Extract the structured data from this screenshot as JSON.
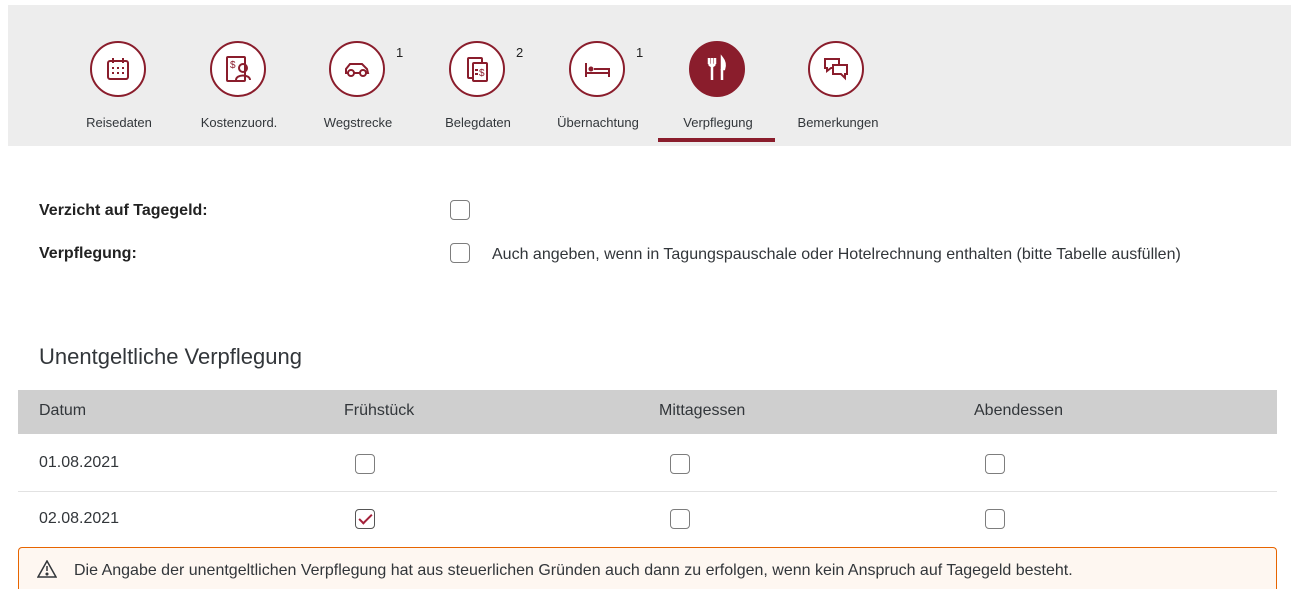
{
  "tabs": [
    {
      "label": "Reisedaten",
      "icon": "calendar-icon",
      "count": "",
      "active": false
    },
    {
      "label": "Kostenzuord.",
      "icon": "cost-assignment-icon",
      "count": "",
      "active": false
    },
    {
      "label": "Wegstrecke",
      "icon": "car-icon",
      "count": "1",
      "active": false
    },
    {
      "label": "Belegdaten",
      "icon": "receipt-icon",
      "count": "2",
      "active": false
    },
    {
      "label": "Übernachtung",
      "icon": "bed-icon",
      "count": "1",
      "active": false
    },
    {
      "label": "Verpflegung",
      "icon": "cutlery-icon",
      "count": "",
      "active": true
    },
    {
      "label": "Bemerkungen",
      "icon": "comments-icon",
      "count": "",
      "active": false
    }
  ],
  "form": {
    "verzicht_label": "Verzicht auf Tagegeld:",
    "verzicht_checked": false,
    "verpflegung_label": "Verpflegung:",
    "verpflegung_checked": false,
    "verpflegung_hint": "Auch angeben, wenn in Tagungspauschale oder Hotelrechnung enthalten (bitte Tabelle ausfüllen)"
  },
  "section_title": "Unentgeltliche Verpflegung",
  "table": {
    "headers": [
      "Datum",
      "Frühstück",
      "Mittagessen",
      "Abendessen"
    ],
    "rows": [
      {
        "date": "01.08.2021",
        "fruehstueck": false,
        "mittagessen": false,
        "abendessen": false
      },
      {
        "date": "02.08.2021",
        "fruehstueck": true,
        "mittagessen": false,
        "abendessen": false
      }
    ]
  },
  "warning": {
    "icon": "warning-icon",
    "text": "Die Angabe der unentgeltlichen Verpflegung hat aus steuerlichen Gründen auch dann zu erfolgen, wenn kein Anspruch auf Tagegeld besteht."
  },
  "colors": {
    "accent": "#8a1d2c",
    "tabbar_bg": "#ededed",
    "table_header_bg": "#cfcfcf",
    "warning_border": "#e76500"
  }
}
